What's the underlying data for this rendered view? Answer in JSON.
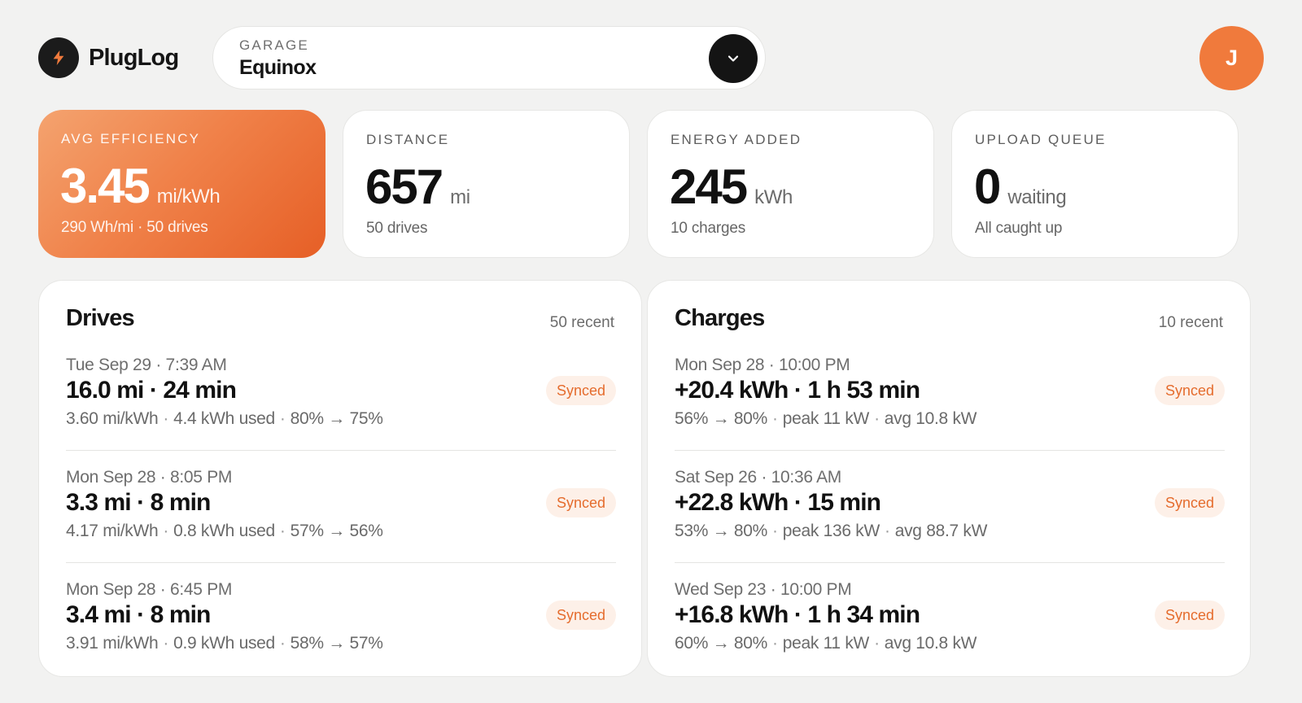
{
  "app": {
    "name": "PlugLog",
    "logo_icon": "bolt-icon"
  },
  "garage": {
    "label": "GARAGE",
    "value": "Equinox"
  },
  "user": {
    "initial": "J",
    "avatar_color": "#f07a3c"
  },
  "colors": {
    "accent": "#f07a3c",
    "badge_text": "#e56c2d",
    "badge_bg": "#fdf0e8"
  },
  "stats": [
    {
      "label": "AVG EFFICIENCY",
      "value": "3.45",
      "unit": "mi/kWh",
      "sub": "290 Wh/mi · 50 drives"
    },
    {
      "label": "DISTANCE",
      "value": "657",
      "unit": "mi",
      "sub": "50 drives"
    },
    {
      "label": "ENERGY ADDED",
      "value": "245",
      "unit": "kWh",
      "sub": "10 charges"
    },
    {
      "label": "UPLOAD QUEUE",
      "value": "0",
      "unit": "waiting",
      "sub": "All caught up"
    }
  ],
  "drives": {
    "title": "Drives",
    "count": "50 recent",
    "items": [
      {
        "date": "Tue Sep 29 · 7:39 AM",
        "main": "16.0 mi · 24 min",
        "d1": "3.60 mi/kWh",
        "d2": "4.4 kWh used",
        "d3": "80% → 75%",
        "status": "Synced"
      },
      {
        "date": "Mon Sep 28 · 8:05 PM",
        "main": "3.3 mi · 8 min",
        "d1": "4.17 mi/kWh",
        "d2": "0.8 kWh used",
        "d3": "57% → 56%",
        "status": "Synced"
      },
      {
        "date": "Mon Sep 28 · 6:45 PM",
        "main": "3.4 mi · 8 min",
        "d1": "3.91 mi/kWh",
        "d2": "0.9 kWh used",
        "d3": "58% → 57%",
        "status": "Synced"
      }
    ]
  },
  "charges": {
    "title": "Charges",
    "count": "10 recent",
    "items": [
      {
        "date": "Mon Sep 28 · 10:00 PM",
        "main": "+20.4 kWh · 1 h 53 min",
        "d1": "56% → 80%",
        "d2": "peak 11 kW",
        "d3": "avg 10.8 kW",
        "status": "Synced"
      },
      {
        "date": "Sat Sep 26 · 10:36 AM",
        "main": "+22.8 kWh · 15 min",
        "d1": "53% → 80%",
        "d2": "peak 136 kW",
        "d3": "avg 88.7 kW",
        "status": "Synced"
      },
      {
        "date": "Wed Sep 23 · 10:00 PM",
        "main": "+16.8 kWh · 1 h 34 min",
        "d1": "60% → 80%",
        "d2": "peak 11 kW",
        "d3": "avg 10.8 kW",
        "status": "Synced"
      }
    ]
  }
}
